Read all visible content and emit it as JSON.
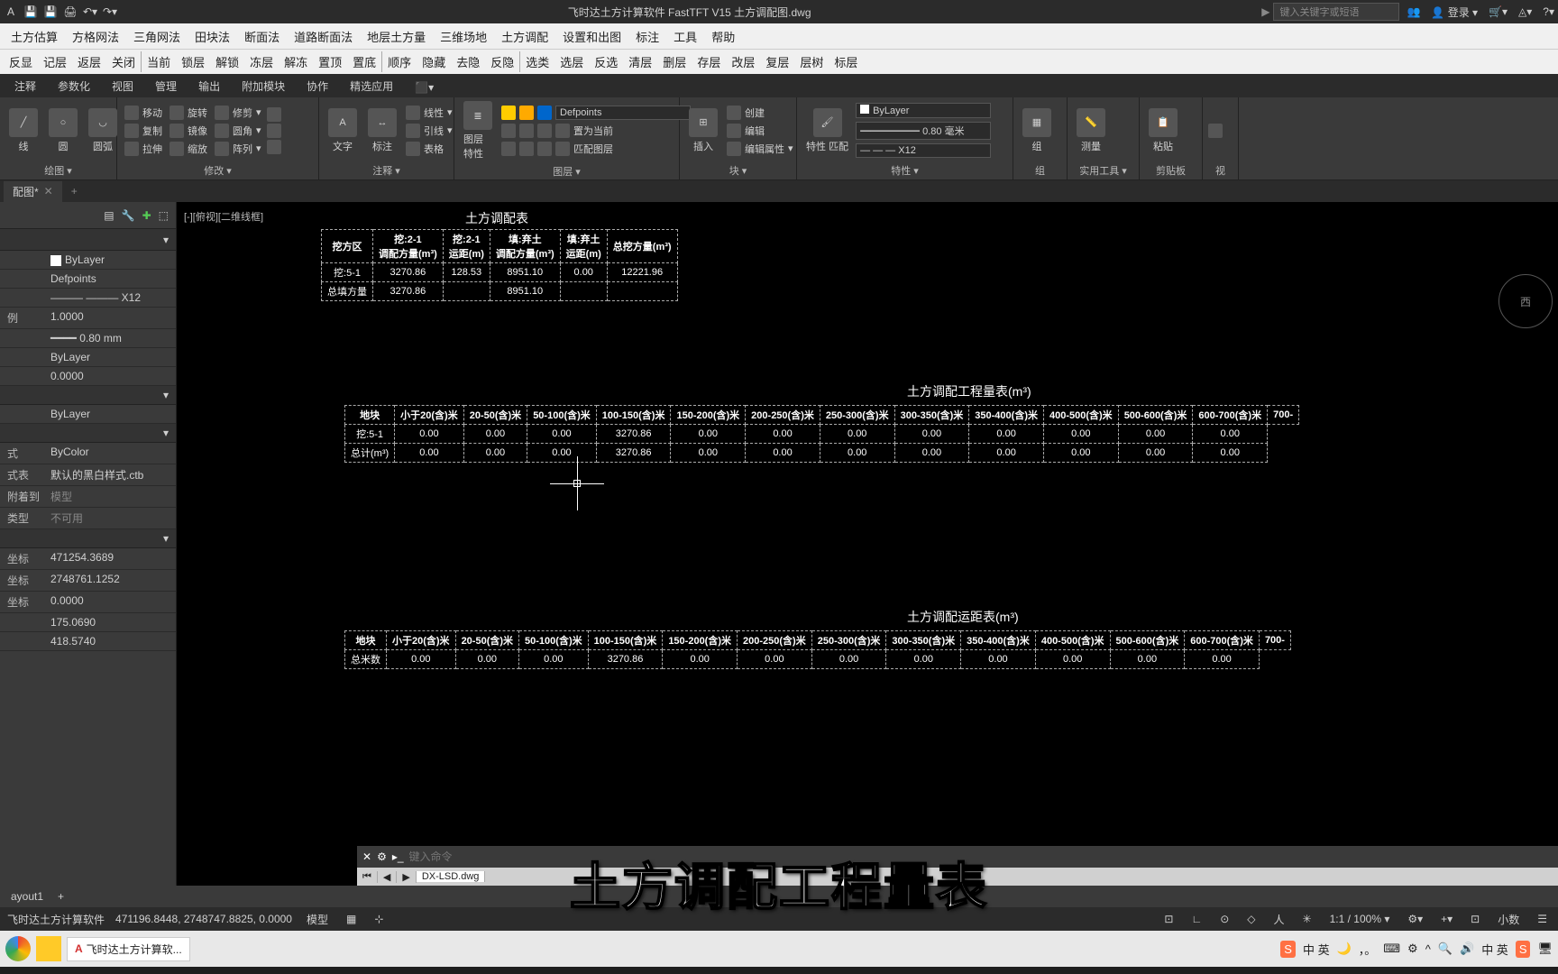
{
  "titlebar": {
    "title": "飞时达土方计算软件 FastTFT V15    土方调配图.dwg",
    "search_placeholder": "键入关键字或短语",
    "login": "登录"
  },
  "menubar": [
    "土方估算",
    "方格网法",
    "三角网法",
    "田块法",
    "断面法",
    "道路断面法",
    "地层土方量",
    "三维场地",
    "土方调配",
    "设置和出图",
    "标注",
    "工具",
    "帮助"
  ],
  "toolbar": [
    "反显",
    "记层",
    "返层",
    "关闭",
    "当前",
    "锁层",
    "解锁",
    "冻层",
    "解冻",
    "置顶",
    "置底",
    "顺序",
    "隐藏",
    "去隐",
    "反隐",
    "选类",
    "选层",
    "反选",
    "清层",
    "删层",
    "存层",
    "改层",
    "复层",
    "层树",
    "标层"
  ],
  "ribbon_tabs": [
    "注释",
    "参数化",
    "视图",
    "管理",
    "输出",
    "附加模块",
    "协作",
    "精选应用"
  ],
  "ribbon": {
    "panel_draw": {
      "label": "绘图 ▾",
      "items": [
        "线",
        "圆",
        "圆弧"
      ]
    },
    "panel_modify": {
      "label": "修改 ▾",
      "items": [
        "移动",
        "复制",
        "拉伸",
        "旋转",
        "镜像",
        "缩放",
        "修剪",
        "圆角",
        "阵列"
      ]
    },
    "panel_annot": {
      "label": "注释 ▾",
      "items": [
        "文字",
        "标注",
        "表格",
        "线性",
        "引线"
      ]
    },
    "panel_layer": {
      "label": "图层 ▾",
      "big": "图层\n特性",
      "combo": "Defpoints",
      "items": [
        "置为当前",
        "匹配图层"
      ]
    },
    "panel_block": {
      "label": "块 ▾",
      "big": "插入",
      "items": [
        "创建",
        "编辑",
        "编辑属性"
      ]
    },
    "panel_props": {
      "label": "特性 ▾",
      "big": "特性\n匹配",
      "layer": "ByLayer",
      "lw": "0.80 毫米",
      "lt": "X12"
    },
    "panel_group": {
      "label": "组",
      "big": "组"
    },
    "panel_util": {
      "label": "实用工具 ▾",
      "big": "测量"
    },
    "panel_clip": {
      "label": "剪贴板",
      "big": "粘贴"
    },
    "panel_view": {
      "label": "视"
    }
  },
  "filetab": {
    "name": "配图*"
  },
  "props_panel": {
    "layer_color": "ByLayer",
    "layer_name": "Defpoints",
    "linetype": "——— ——— X12",
    "scale_label": "例",
    "scale": "1.0000",
    "lineweight": "0.80 mm",
    "transparency": "ByLayer",
    "elevation": "0.0000",
    "material": "ByLayer",
    "plotstyle_label": "式",
    "plotstyle": "ByColor",
    "plotstyletable_label": "式表",
    "plotstyletable": "默认的黑白样式.ctb",
    "attach_label": "附着到",
    "attach": "模型",
    "type_label": "类型",
    "type": "不可用",
    "x_label": "坐标",
    "x": "471254.3689",
    "y_label": "坐标",
    "y": "2748761.1252",
    "z_label": "坐标",
    "z": "0.0000",
    "h": "175.0690",
    "w": "418.5740"
  },
  "viewlabel": "[-][俯视][二维线框]",
  "table1": {
    "title": "土方调配表",
    "headers": [
      "挖方区",
      "挖:2-1\n调配方量(m³)",
      "挖:2-1\n运距(m)",
      "填:弃土\n调配方量(m³)",
      "填:弃土\n运距(m)",
      "总挖方量(m³)"
    ],
    "rows": [
      [
        "挖:5-1",
        "3270.86",
        "128.53",
        "8951.10",
        "0.00",
        "12221.96"
      ],
      [
        "总填方量",
        "3270.86",
        "",
        "8951.10",
        "",
        ""
      ]
    ]
  },
  "table2": {
    "title": "土方调配工程量表(m³)",
    "headers": [
      "地块",
      "小于20(含)米",
      "20-50(含)米",
      "50-100(含)米",
      "100-150(含)米",
      "150-200(含)米",
      "200-250(含)米",
      "250-300(含)米",
      "300-350(含)米",
      "350-400(含)米",
      "400-500(含)米",
      "500-600(含)米",
      "600-700(含)米",
      "700-"
    ],
    "rows": [
      [
        "挖:5-1",
        "0.00",
        "0.00",
        "0.00",
        "3270.86",
        "0.00",
        "0.00",
        "0.00",
        "0.00",
        "0.00",
        "0.00",
        "0.00",
        "0.00"
      ],
      [
        "总计(m³)",
        "0.00",
        "0.00",
        "0.00",
        "3270.86",
        "0.00",
        "0.00",
        "0.00",
        "0.00",
        "0.00",
        "0.00",
        "0.00",
        "0.00"
      ]
    ]
  },
  "table3": {
    "title": "土方调配运距表(m³)",
    "headers": [
      "地块",
      "小于20(含)米",
      "20-50(含)米",
      "50-100(含)米",
      "100-150(含)米",
      "150-200(含)米",
      "200-250(含)米",
      "250-300(含)米",
      "300-350(含)米",
      "350-400(含)米",
      "400-500(含)米",
      "500-600(含)米",
      "600-700(含)米",
      "700-"
    ],
    "rows": [
      [
        "总米数",
        "0.00",
        "0.00",
        "0.00",
        "3270.86",
        "0.00",
        "0.00",
        "0.00",
        "0.00",
        "0.00",
        "0.00",
        "0.00",
        "0.00"
      ]
    ]
  },
  "cmdline": {
    "placeholder": "键入命令"
  },
  "sheet_tab": "DX-LSD.dwg",
  "layout_tabs": [
    "ayout1",
    "+"
  ],
  "statusbar": {
    "app": "飞时达土方计算软件",
    "coords": "471196.8448, 2748747.8825, 0.0000",
    "space": "模型",
    "zoom": "1:1 / 100% ▾",
    "extra": "小数"
  },
  "taskbar": {
    "app": "飞时达土方计算软...",
    "ime": "中 英"
  },
  "navcube": "西",
  "caption": "土方调配工程量表"
}
